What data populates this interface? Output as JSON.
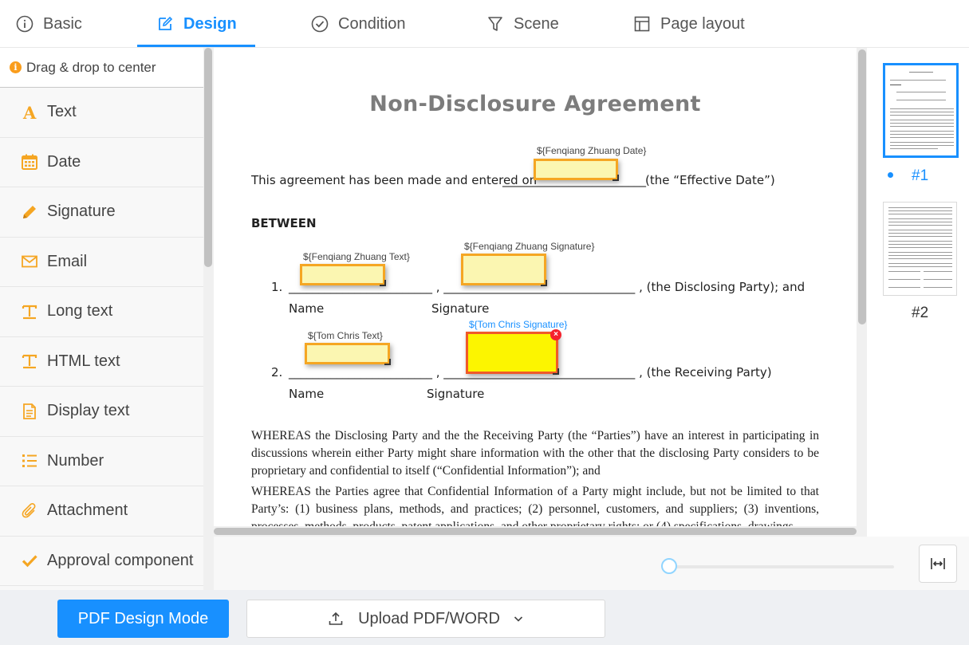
{
  "tabs": [
    {
      "label": "Basic",
      "icon": "info-circle-icon"
    },
    {
      "label": "Design",
      "icon": "edit-icon",
      "active": true
    },
    {
      "label": "Condition",
      "icon": "check-circle-icon"
    },
    {
      "label": "Scene",
      "icon": "filter-icon"
    },
    {
      "label": "Page layout",
      "icon": "layout-icon"
    }
  ],
  "sidebar": {
    "hint": "Drag & drop to center",
    "items": [
      {
        "label": "Text",
        "icon": "text-a-icon"
      },
      {
        "label": "Date",
        "icon": "calendar-icon"
      },
      {
        "label": "Signature",
        "icon": "pencil-icon"
      },
      {
        "label": "Email",
        "icon": "envelope-icon"
      },
      {
        "label": "Long text",
        "icon": "long-text-icon"
      },
      {
        "label": "HTML text",
        "icon": "html-text-icon"
      },
      {
        "label": "Display text",
        "icon": "file-text-icon"
      },
      {
        "label": "Number",
        "icon": "list-ordered-icon"
      },
      {
        "label": "Attachment",
        "icon": "paperclip-icon"
      },
      {
        "label": "Approval component",
        "icon": "check-icon"
      }
    ]
  },
  "document": {
    "title": "Non-Disclosure Agreement",
    "intro_left": "This agreement has been made and entered on",
    "intro_blank": "________________________",
    "intro_right": "(the “Effective Date”)",
    "between": "BETWEEN",
    "party1": {
      "number": "1.",
      "line": "________________________ , ________________________________ , (the Disclosing Party); and",
      "name_label": "Name",
      "signature_label": "Signature"
    },
    "party2": {
      "number": "2.",
      "line": "________________________ , ________________________________ , (the Receiving Party)",
      "name_label": "Name",
      "signature_label": "Signature"
    },
    "para1": "WHEREAS the Disclosing Party and the the Receiving Party (the “Parties”) have an interest in participating in discussions wherein either Party might share information with the other that the disclosing Party considers to be proprietary and confidential to itself (“Confidential Information”); and",
    "para2": "WHEREAS the Parties agree that Confidential Information of a Party might include, but not be limited to that Party’s: (1) business plans, methods, and practices; (2) personnel, customers, and suppliers; (3) inventions, processes, methods, products, patent applications, and other proprietary rights; or (4) specifications, drawings,"
  },
  "fields": {
    "fenqiang_date": "${Fenqiang Zhuang Date}",
    "fenqiang_text": "${Fenqiang Zhuang Text}",
    "fenqiang_signature": "${Fenqiang Zhuang Signature}",
    "tom_text": "${Tom Chris Text}",
    "tom_signature": "${Tom Chris Signature}",
    "close_glyph": "×"
  },
  "thumbnails": [
    {
      "label": "#1",
      "active": true
    },
    {
      "label": "#2",
      "active": false
    }
  ],
  "zoom": {
    "level": 0.0
  },
  "bottom": {
    "design_mode": "PDF Design Mode",
    "upload": "Upload PDF/WORD"
  },
  "colors": {
    "accent": "#1890ff",
    "field_fill": "#fbf6b1",
    "field_border": "#f5a623",
    "active_field_fill": "#fcf500",
    "active_field_border": "#f05a28",
    "icon_orange": "#f5a623"
  }
}
